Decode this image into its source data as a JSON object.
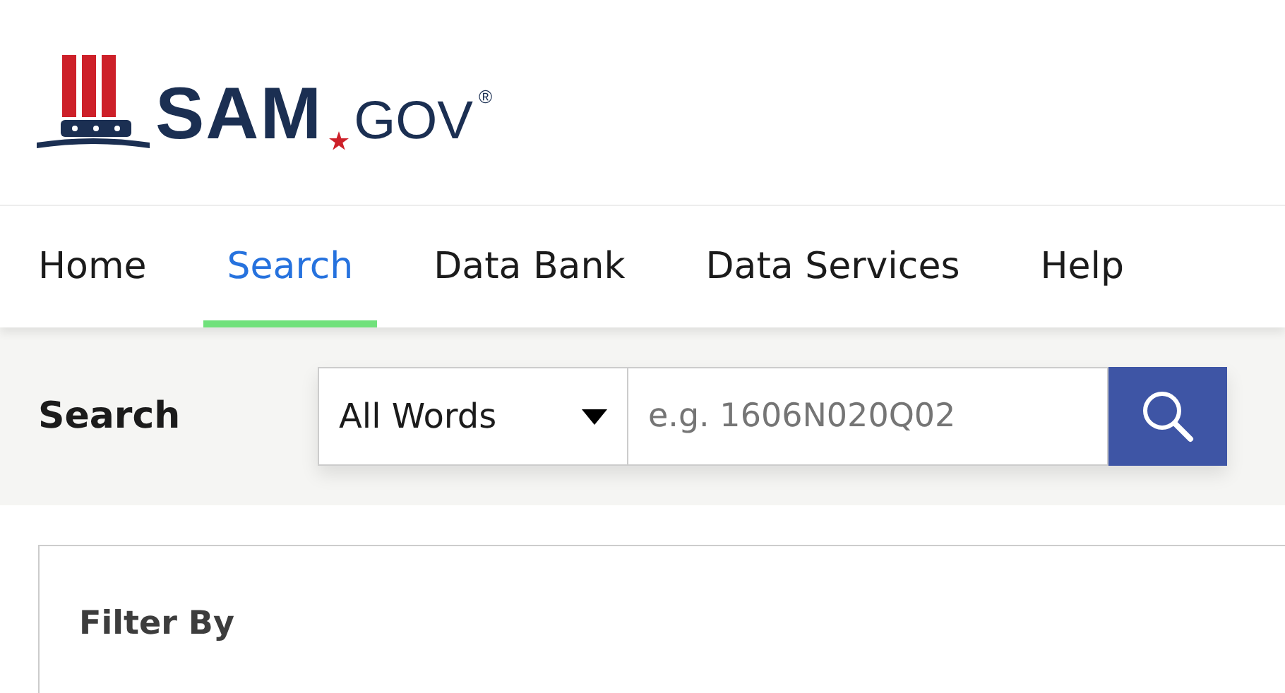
{
  "logo": {
    "name": "SAM",
    "suffix": "GOV",
    "mark": "®"
  },
  "nav": [
    {
      "label": "Home",
      "selected": false
    },
    {
      "label": "Search",
      "selected": true
    },
    {
      "label": "Data Bank",
      "selected": false
    },
    {
      "label": "Data Services",
      "selected": false
    },
    {
      "label": "Help",
      "selected": false
    }
  ],
  "search": {
    "label": "Search",
    "scope": "All Words",
    "placeholder": "e.g. 1606N020Q02"
  },
  "filter": {
    "title": "Filter By"
  }
}
